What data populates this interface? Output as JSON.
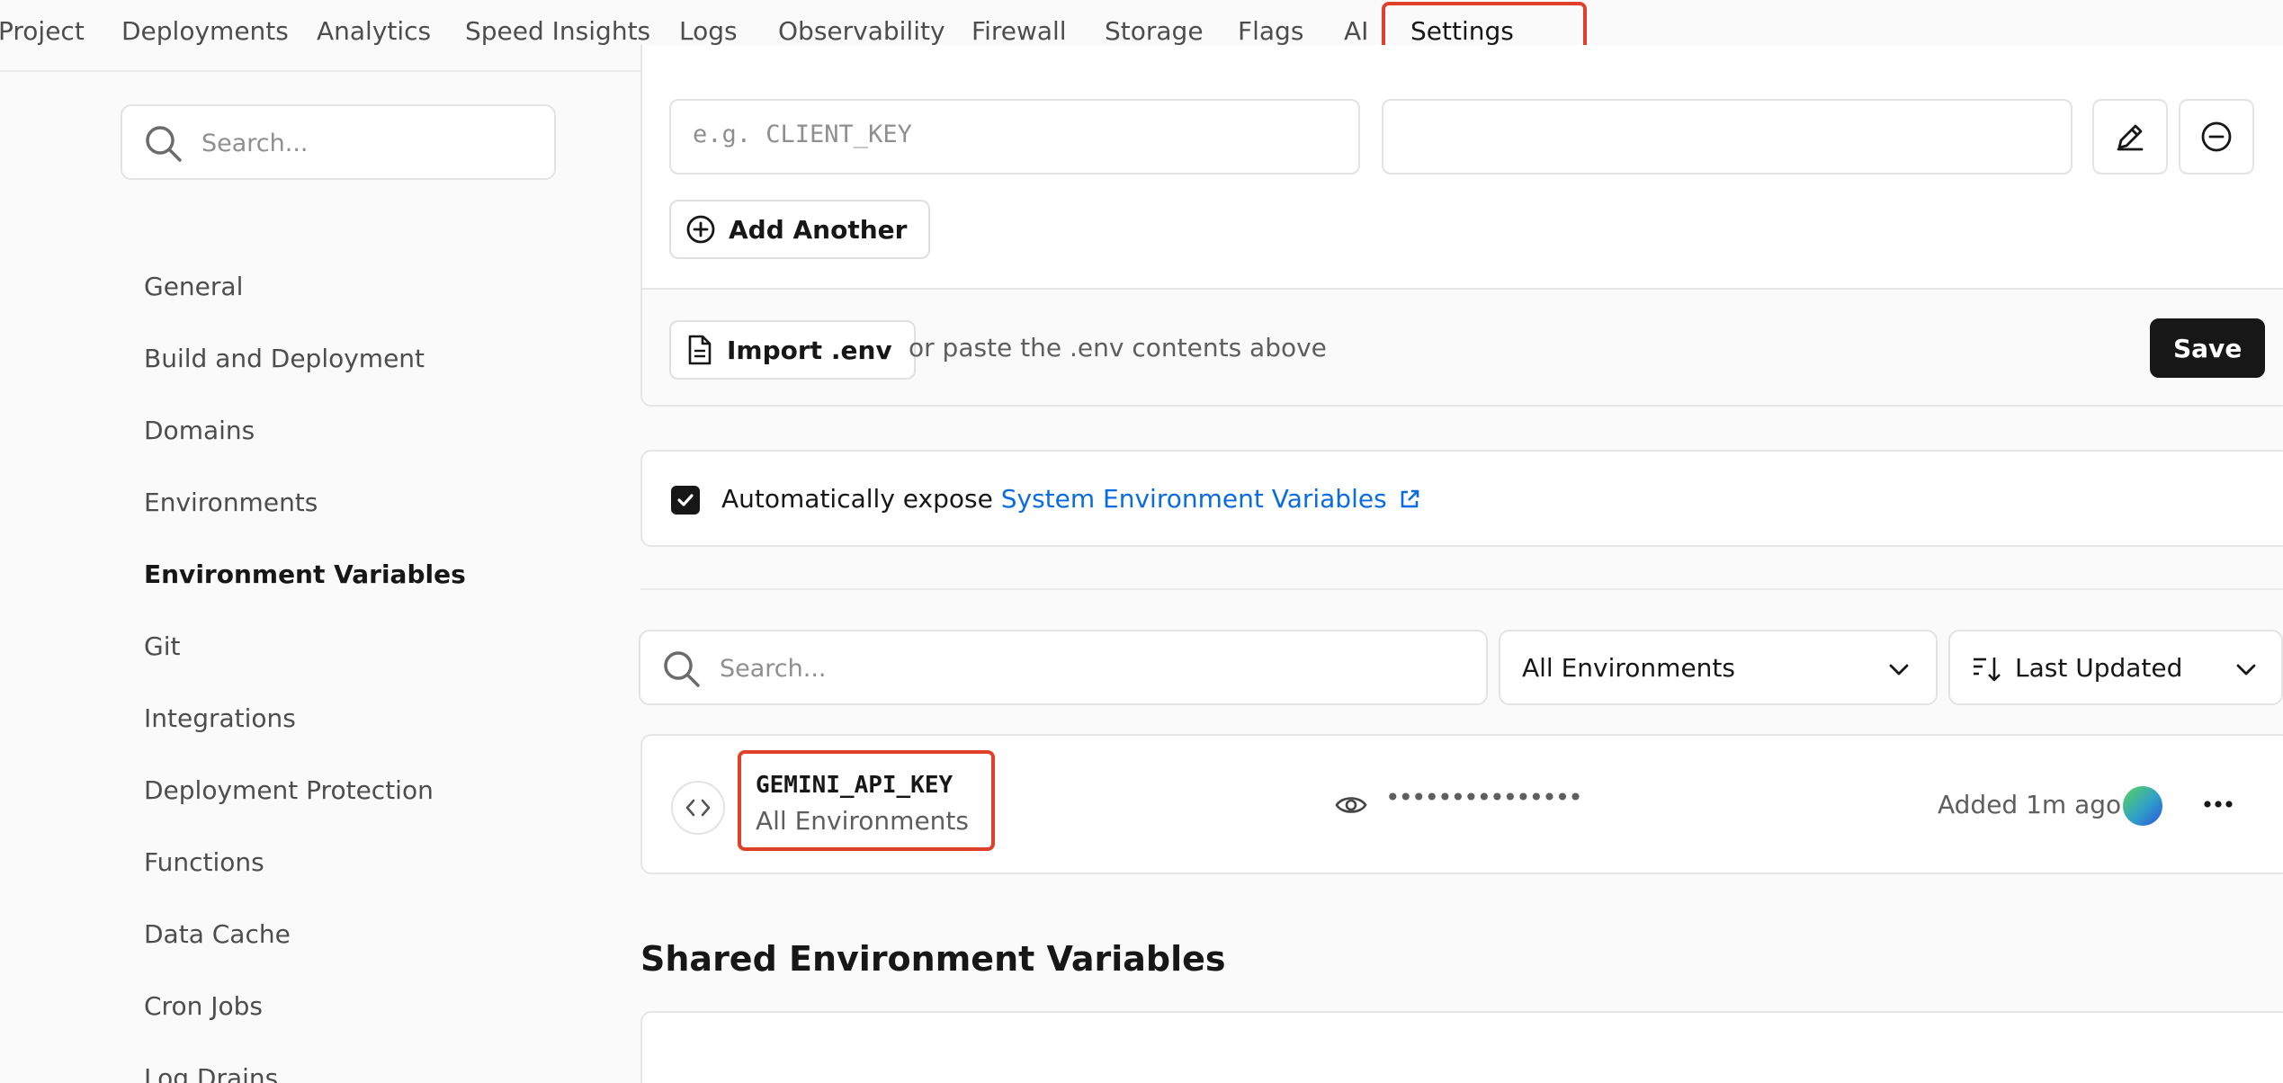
{
  "nav": {
    "tabs": [
      {
        "label": "Project"
      },
      {
        "label": "Deployments"
      },
      {
        "label": "Analytics"
      },
      {
        "label": "Speed Insights"
      },
      {
        "label": "Logs"
      },
      {
        "label": "Observability"
      },
      {
        "label": "Firewall"
      },
      {
        "label": "Storage"
      },
      {
        "label": "Flags"
      },
      {
        "label": "AI"
      },
      {
        "label": "Settings"
      }
    ],
    "active": "Settings"
  },
  "sidebar": {
    "search_placeholder": "Search...",
    "items": [
      {
        "label": "General"
      },
      {
        "label": "Build and Deployment"
      },
      {
        "label": "Domains"
      },
      {
        "label": "Environments"
      },
      {
        "label": "Environment Variables"
      },
      {
        "label": "Git"
      },
      {
        "label": "Integrations"
      },
      {
        "label": "Deployment Protection"
      },
      {
        "label": "Functions"
      },
      {
        "label": "Data Cache"
      },
      {
        "label": "Cron Jobs"
      },
      {
        "label": "Log Drains"
      }
    ],
    "active": "Environment Variables"
  },
  "form": {
    "key_placeholder": "e.g. CLIENT_KEY",
    "value_value": "",
    "add_another_label": "Add Another",
    "import_label": "Import .env",
    "paste_hint": "or paste the .env contents above",
    "save_label": "Save"
  },
  "system_vars": {
    "checked": true,
    "prefix": "Automatically expose",
    "link_text": "System Environment Variables"
  },
  "filters": {
    "search_placeholder": "Search...",
    "environment_label": "All Environments",
    "sort_label": "Last Updated"
  },
  "variables": [
    {
      "name": "GEMINI_API_KEY",
      "environments": "All Environments",
      "masked_value": "•••••••••••••••",
      "added": "Added 1m ago"
    }
  ],
  "shared": {
    "title": "Shared Environment Variables"
  },
  "colors": {
    "accent_link": "#0a6ce0",
    "primary_button": "#171717",
    "highlight_box": "#e0402a"
  }
}
